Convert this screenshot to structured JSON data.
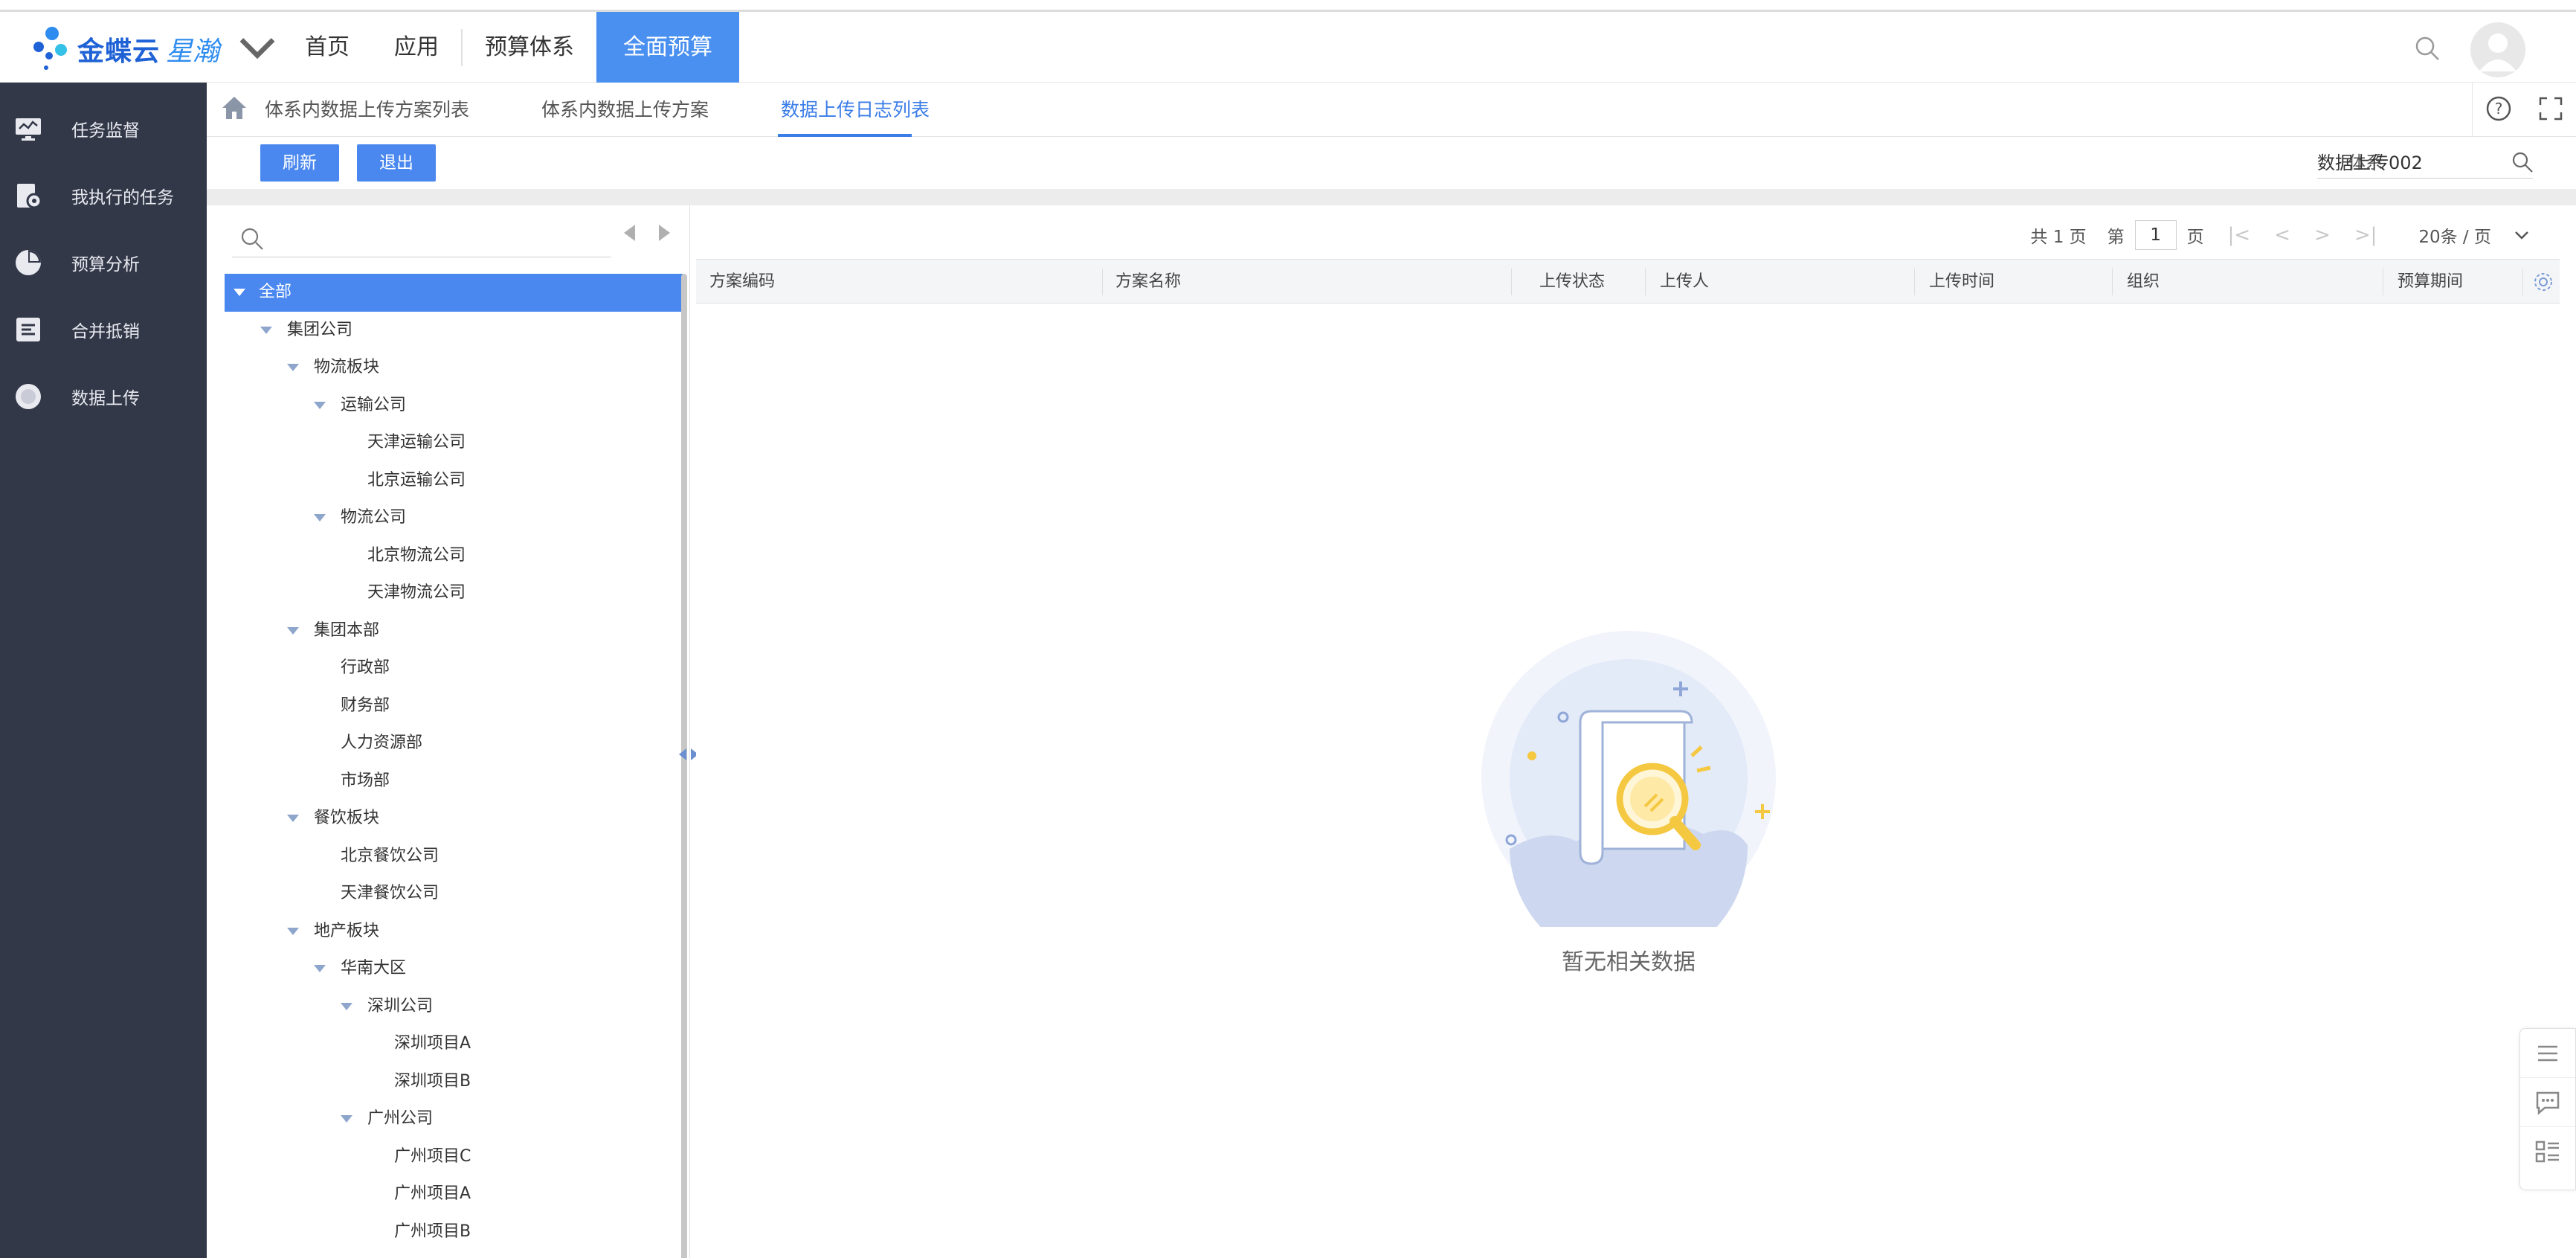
{
  "brand": {
    "name": "金蝶云",
    "product": "星瀚"
  },
  "nav": [
    "首页",
    "应用",
    "预算体系",
    "全面预算"
  ],
  "nav_active": "全面预算",
  "sidebar": [
    {
      "label": "任务监督",
      "icon": "monitor-icon"
    },
    {
      "label": "我执行的任务",
      "icon": "task-gear-icon"
    },
    {
      "label": "预算分析",
      "icon": "pie-chart-icon"
    },
    {
      "label": "合并抵销",
      "icon": "merge-icon"
    },
    {
      "label": "数据上传",
      "icon": "circle-upload-icon"
    }
  ],
  "tabs": [
    "体系内数据上传方案列表",
    "体系内数据上传方案",
    "数据上传日志列表"
  ],
  "tab_active": "数据上传日志列表",
  "toolbar": {
    "refresh": "刷新",
    "exit": "退出",
    "system_label": "体系",
    "system_value": "数据上传002"
  },
  "tree": [
    {
      "label": "全部",
      "level": 0,
      "expanded": true,
      "selected": true
    },
    {
      "label": "集团公司",
      "level": 1,
      "expanded": true
    },
    {
      "label": "物流板块",
      "level": 2,
      "expanded": true
    },
    {
      "label": "运输公司",
      "level": 3,
      "expanded": true
    },
    {
      "label": "天津运输公司",
      "level": 4
    },
    {
      "label": "北京运输公司",
      "level": 4
    },
    {
      "label": "物流公司",
      "level": 3,
      "expanded": true
    },
    {
      "label": "北京物流公司",
      "level": 4
    },
    {
      "label": "天津物流公司",
      "level": 4
    },
    {
      "label": "集团本部",
      "level": 2,
      "expanded": true
    },
    {
      "label": "行政部",
      "level": 3
    },
    {
      "label": "财务部",
      "level": 3
    },
    {
      "label": "人力资源部",
      "level": 3
    },
    {
      "label": "市场部",
      "level": 3
    },
    {
      "label": "餐饮板块",
      "level": 2,
      "expanded": true
    },
    {
      "label": "北京餐饮公司",
      "level": 3
    },
    {
      "label": "天津餐饮公司",
      "level": 3
    },
    {
      "label": "地产板块",
      "level": 2,
      "expanded": true
    },
    {
      "label": "华南大区",
      "level": 3,
      "expanded": true
    },
    {
      "label": "深圳公司",
      "level": 4,
      "expanded": true
    },
    {
      "label": "深圳项目A",
      "level": 5
    },
    {
      "label": "深圳项目B",
      "level": 5
    },
    {
      "label": "广州公司",
      "level": 4,
      "expanded": true
    },
    {
      "label": "广州项目C",
      "level": 5
    },
    {
      "label": "广州项目A",
      "level": 5
    },
    {
      "label": "广州项目B",
      "level": 5
    }
  ],
  "pager": {
    "total": "共 1 页",
    "page_prefix": "第",
    "page": "1",
    "page_suffix": "页",
    "page_size": "20条 / 页"
  },
  "columns": [
    "方案编码",
    "方案名称",
    "上传状态",
    "上传人",
    "上传时间",
    "组织",
    "预算期间"
  ],
  "empty_text": "暂无相关数据",
  "colors": {
    "accent": "#4a88f0",
    "sidebar": "#333849"
  }
}
